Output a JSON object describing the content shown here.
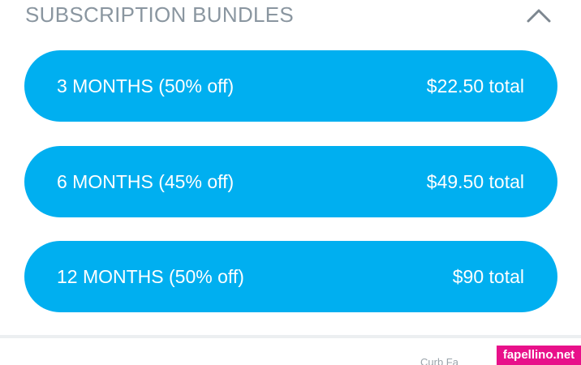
{
  "section": {
    "title": "SUBSCRIPTION BUNDLES",
    "toggle_icon": "chevron-up-icon"
  },
  "bundles": [
    {
      "label": "3 MONTHS (50% off)",
      "price": "$22.50 total"
    },
    {
      "label": "6 MONTHS (45% off)",
      "price": "$49.50 total"
    },
    {
      "label": "12 MONTHS (50% off)",
      "price": "$90 total"
    }
  ],
  "footer": {
    "partial_text": "Curb Fa"
  },
  "watermark": {
    "text": "fapellino.net"
  },
  "colors": {
    "button_blue": "#00aff0",
    "title_gray": "#8a96a0",
    "watermark_pink": "#e8108a"
  }
}
